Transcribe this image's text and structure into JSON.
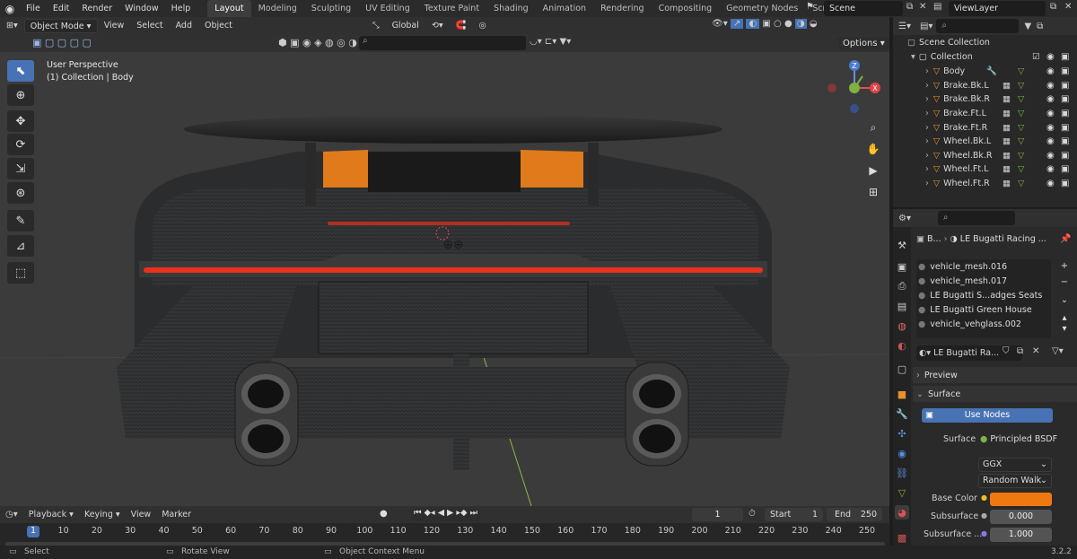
{
  "topbar": {
    "menus": [
      "File",
      "Edit",
      "Render",
      "Window",
      "Help"
    ],
    "workspaces": [
      "Layout",
      "Modeling",
      "Sculpting",
      "UV Editing",
      "Texture Paint",
      "Shading",
      "Animation",
      "Rendering",
      "Compositing",
      "Geometry Nodes",
      "Scripting"
    ],
    "active_workspace": "Layout",
    "scene": "Scene",
    "view_layer": "ViewLayer",
    "add_workspace": "+"
  },
  "viewport": {
    "mode": "Object Mode",
    "menus": [
      "View",
      "Select",
      "Add",
      "Object"
    ],
    "orientation": "Global",
    "perspective": "User Perspective",
    "context": "(1) Collection | Body",
    "options": "Options",
    "gizmo_z": "Z",
    "gizmo_x": "X",
    "gizmo_y": "Y",
    "brake_light_color": "#e8321e",
    "body_color": "#2a2c2e",
    "accent_color": "#e07a1a"
  },
  "outliner": {
    "root": "Scene Collection",
    "collection": "Collection",
    "items": [
      "Body",
      "Brake.Bk.L",
      "Brake.Bk.R",
      "Brake.Ft.L",
      "Brake.Ft.R",
      "Wheel.Bk.L",
      "Wheel.Bk.R",
      "Wheel.Ft.L",
      "Wheel.Ft.R"
    ]
  },
  "properties": {
    "breadcrumb_object": "B...",
    "breadcrumb_material": "LE Bugatti Racing ...",
    "slots": [
      "vehicle_mesh.016",
      "vehicle_mesh.017",
      "LE Bugatti S...adges Seats",
      "LE Bugatti Green House",
      "vehicle_vehglass.002"
    ],
    "material_name": "LE Bugatti Ra...",
    "preview_label": "Preview",
    "surface_label": "Surface",
    "use_nodes": "Use Nodes",
    "surface_field_label": "Surface",
    "surface_value": "Principled BSDF",
    "distribution": "GGX",
    "subsurface_method": "Random Walk",
    "base_color_label": "Base Color",
    "base_color": "#f07810",
    "subsurface_label": "Subsurface",
    "subsurface_value": "0.000",
    "subsurface_radius_label": "Subsurface ...",
    "subsurface_radius_value": "1.000"
  },
  "timeline": {
    "menus": [
      "Playback",
      "Keying",
      "View",
      "Marker"
    ],
    "current_frame": "1",
    "start_label": "Start",
    "start_value": "1",
    "end_label": "End",
    "end_value": "250",
    "ruler": [
      "1",
      "10",
      "20",
      "30",
      "40",
      "50",
      "60",
      "70",
      "80",
      "90",
      "100",
      "110",
      "120",
      "130",
      "140",
      "150",
      "160",
      "170",
      "180",
      "190",
      "200",
      "210",
      "220",
      "230",
      "240",
      "250"
    ]
  },
  "statusbar": {
    "select": "Select",
    "rotate": "Rotate View",
    "context_menu": "Object Context Menu",
    "version": "3.2.2"
  }
}
